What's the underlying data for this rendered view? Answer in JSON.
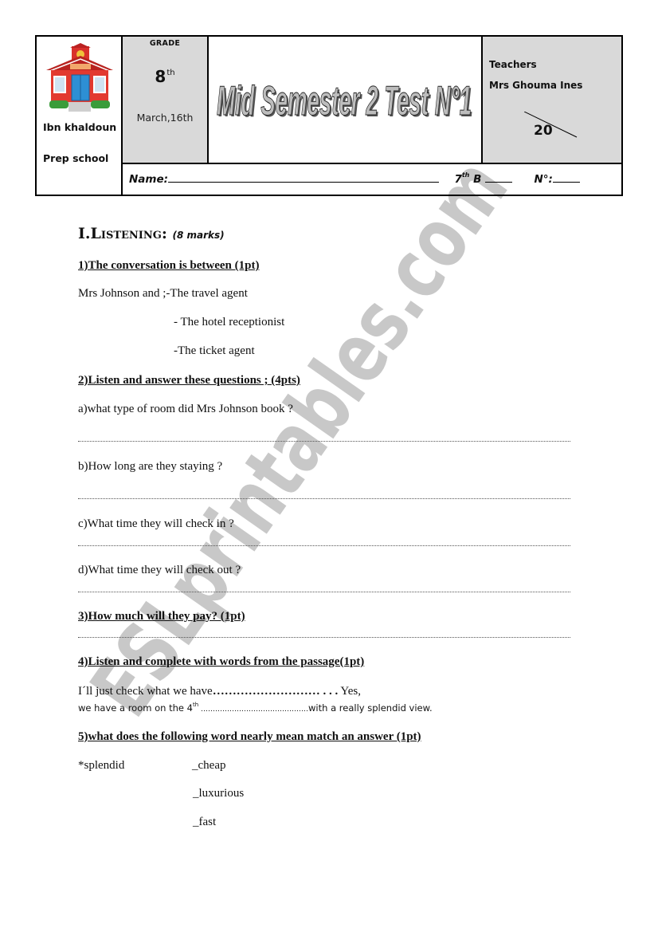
{
  "header": {
    "school": {
      "icon": "school-house-icon",
      "name": "Ibn khaldoun",
      "type": "Prep school"
    },
    "grade": {
      "label": "GRADE",
      "value": "8",
      "suffix": "th",
      "date": "March,16th"
    },
    "title": "Mid Semester 2 Test N°1",
    "teacher": {
      "label": "Teachers",
      "name": "Mrs Ghouma Ines",
      "score_total": "20"
    },
    "student_row": {
      "name_label": "Name:",
      "class_number": "7",
      "class_suffix": "th",
      "class_letter": "B",
      "number_label": "N°:"
    }
  },
  "section": {
    "title": "I.Listening:",
    "marks": "(8 marks)"
  },
  "questions": {
    "q1": {
      "heading": "1)The conversation is between (1pt)",
      "intro": "Mrs Johnson and ;-The travel agent",
      "options": [
        "- The hotel receptionist",
        "-The ticket agent"
      ]
    },
    "q2": {
      "heading": "2)Listen and answer these questions ; (4pts)",
      "items": [
        "a)what type of room did Mrs Johnson book ?",
        "b)How long are they staying ?",
        "c)What time they will check in ?",
        "d)What time they will check out ?"
      ]
    },
    "q3": {
      "heading": "3)How much will they pay?  (1pt)"
    },
    "q4": {
      "heading": "4)Listen and complete with words from the passage(1pt)",
      "line1_start": "I´ll just check what we have",
      "line1_dots": "……………………… . . .",
      "line1_end": " Yes,",
      "line2_start": "we have a room on the 4",
      "line2_sup": "th",
      "line2_dots": " ………………………………………",
      "line2_end": "with a really splendid view."
    },
    "q5": {
      "heading": "5)what does the following word nearly mean match an answer (1pt)",
      "word": "*splendid",
      "options": [
        "_cheap",
        "_luxurious",
        "_fast"
      ]
    }
  },
  "watermark": {
    "text": "ESLprintables.com",
    "color": "#c8c8c8"
  }
}
